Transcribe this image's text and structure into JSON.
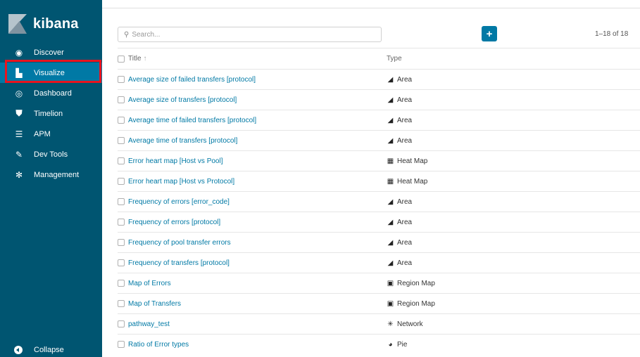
{
  "app": {
    "name": "kibana"
  },
  "nav": {
    "items": [
      {
        "label": "Discover",
        "icon": "compass-icon",
        "glyph": "◉"
      },
      {
        "label": "Visualize",
        "icon": "bar-chart-icon",
        "glyph": "▙"
      },
      {
        "label": "Dashboard",
        "icon": "dashboard-icon",
        "glyph": "◎"
      },
      {
        "label": "Timelion",
        "icon": "shield-icon",
        "glyph": "⛊"
      },
      {
        "label": "APM",
        "icon": "apm-icon",
        "glyph": "☰"
      },
      {
        "label": "Dev Tools",
        "icon": "wrench-icon",
        "glyph": "✎"
      },
      {
        "label": "Management",
        "icon": "gear-icon",
        "glyph": "✻"
      }
    ],
    "active": "Visualize",
    "collapse_label": "Collapse"
  },
  "toolbar": {
    "search_placeholder": "Search...",
    "add_label": "+",
    "pager": "1–18 of 18"
  },
  "table": {
    "headers": {
      "title": "Title",
      "sort": "↑",
      "type": "Type"
    },
    "rows": [
      {
        "title": "Average size of failed transfers [protocol]",
        "type": "Area",
        "type_icon": "area-chart-icon",
        "glyph": "◢"
      },
      {
        "title": "Average size of transfers [protocol]",
        "type": "Area",
        "type_icon": "area-chart-icon",
        "glyph": "◢"
      },
      {
        "title": "Average time of failed transfers [protocol]",
        "type": "Area",
        "type_icon": "area-chart-icon",
        "glyph": "◢"
      },
      {
        "title": "Average time of transfers [protocol]",
        "type": "Area",
        "type_icon": "area-chart-icon",
        "glyph": "◢"
      },
      {
        "title": "Error heart map [Host vs Pool]",
        "type": "Heat Map",
        "type_icon": "heatmap-icon",
        "glyph": "▦"
      },
      {
        "title": "Error heart map [Host vs Protocol]",
        "type": "Heat Map",
        "type_icon": "heatmap-icon",
        "glyph": "▦"
      },
      {
        "title": "Frequency of errors [error_code]",
        "type": "Area",
        "type_icon": "area-chart-icon",
        "glyph": "◢"
      },
      {
        "title": "Frequency of errors [protocol]",
        "type": "Area",
        "type_icon": "area-chart-icon",
        "glyph": "◢"
      },
      {
        "title": "Frequency of pool transfer errors",
        "type": "Area",
        "type_icon": "area-chart-icon",
        "glyph": "◢"
      },
      {
        "title": "Frequency of transfers [protocol]",
        "type": "Area",
        "type_icon": "area-chart-icon",
        "glyph": "◢"
      },
      {
        "title": "Map of Errors",
        "type": "Region Map",
        "type_icon": "region-map-icon",
        "glyph": "▣"
      },
      {
        "title": "Map of Transfers",
        "type": "Region Map",
        "type_icon": "region-map-icon",
        "glyph": "▣"
      },
      {
        "title": "pathway_test",
        "type": "Network",
        "type_icon": "network-icon",
        "glyph": "✳"
      },
      {
        "title": "Ratio of Error types",
        "type": "Pie",
        "type_icon": "pie-chart-icon",
        "glyph": "◕"
      }
    ]
  },
  "colors": {
    "sidebar": "#005571",
    "active": "#0079a5",
    "highlight": "#e8141f",
    "link": "#0079a5"
  }
}
